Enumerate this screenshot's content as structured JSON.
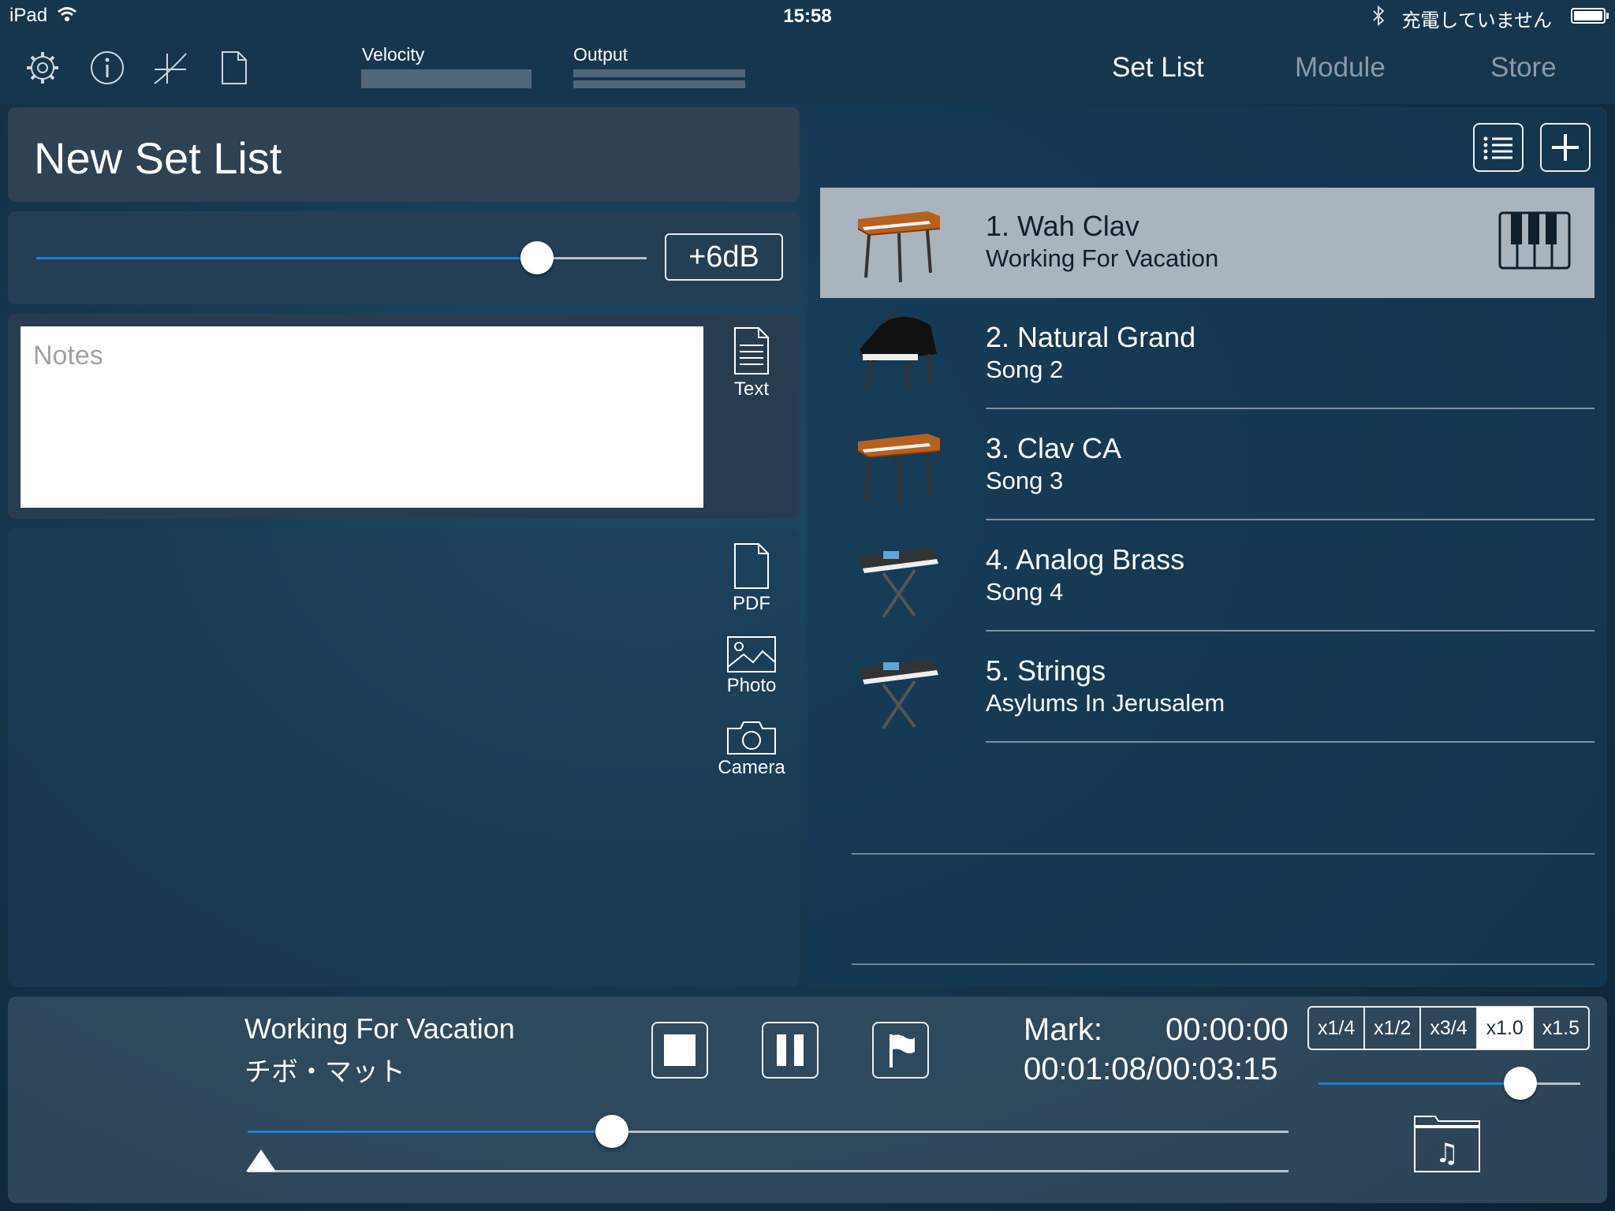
{
  "status_bar": {
    "carrier": "iPad",
    "time": "15:58",
    "charging_text": "充電していません"
  },
  "toolbar": {
    "icons": [
      "gear-icon",
      "info-icon",
      "curve-icon",
      "document-icon"
    ],
    "velocity_label": "Velocity",
    "output_label": "Output",
    "tabs": [
      {
        "label": "Set List",
        "active": true
      },
      {
        "label": "Module",
        "active": false
      },
      {
        "label": "Store",
        "active": false
      }
    ]
  },
  "set_list": {
    "title": "New Set List",
    "level_button": "+6dB",
    "level_value_fraction": 0.82,
    "notes_placeholder": "Notes",
    "attach_buttons": {
      "text": "Text",
      "pdf": "PDF",
      "photo": "Photo",
      "camera": "Camera"
    },
    "items": [
      {
        "title": "1. Wah Clav",
        "song": "Working For Vacation",
        "instrument": "clav",
        "selected": true
      },
      {
        "title": "2. Natural Grand",
        "song": "Song 2",
        "instrument": "grand-piano",
        "selected": false
      },
      {
        "title": "3. Clav CA",
        "song": "Song 3",
        "instrument": "clav",
        "selected": false
      },
      {
        "title": "4. Analog Brass",
        "song": "Song 4",
        "instrument": "synth",
        "selected": false
      },
      {
        "title": "5. Strings",
        "song": "Asylums In Jerusalem",
        "instrument": "synth",
        "selected": false
      }
    ]
  },
  "player": {
    "song_title": "Working For Vacation",
    "artist": "チボ・マット",
    "mark_label": "Mark:",
    "mark_time": "00:00:00",
    "position": "00:01:08",
    "separator": "/",
    "duration": "00:03:15",
    "position_fraction": 0.35,
    "speed_options": [
      "x1/4",
      "x1/2",
      "x3/4",
      "x1.0",
      "x1.5"
    ],
    "speed_selected": "x1.0",
    "speed_slider_fraction": 0.77
  },
  "colors": {
    "accent": "#1a7de0",
    "selected_row": "#a9b4bc",
    "panel": "#2f4253"
  }
}
